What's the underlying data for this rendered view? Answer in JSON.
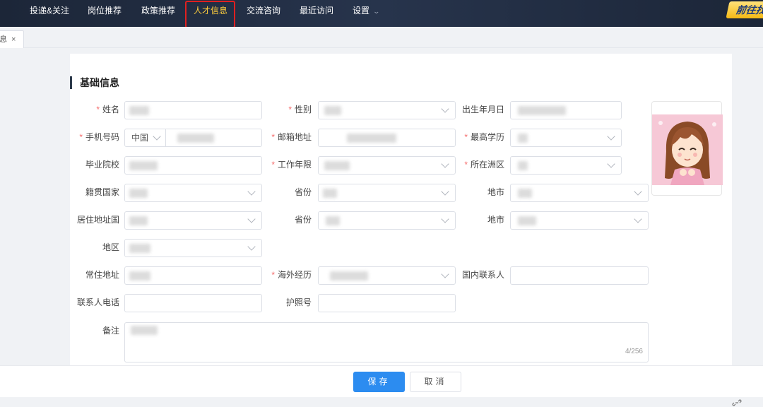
{
  "nav": {
    "items": [
      "投递&关注",
      "岗位推荐",
      "政策推荐",
      "人才信息",
      "交流咨询",
      "最近访问",
      "设置"
    ],
    "active_index": 3,
    "goto_label": "前往找"
  },
  "tab": {
    "label": "息",
    "close": "×"
  },
  "section": {
    "title": "基础信息"
  },
  "form": {
    "name": {
      "label": "姓名",
      "required": "*"
    },
    "gender": {
      "label": "性别",
      "required": "*"
    },
    "birth": {
      "label": "出生年月日"
    },
    "phone": {
      "label": "手机号码",
      "required": "*",
      "country": "中国"
    },
    "email": {
      "label": "邮箱地址",
      "required": "*"
    },
    "education": {
      "label": "最高学历",
      "required": "*"
    },
    "school": {
      "label": "毕业院校"
    },
    "work_years": {
      "label": "工作年限",
      "required": "*"
    },
    "continent": {
      "label": "所在洲区",
      "required": "*"
    },
    "native_country": {
      "label": "籍贯国家"
    },
    "native_province": {
      "label": "省份"
    },
    "native_city": {
      "label": "地市"
    },
    "residence_country": {
      "label": "居住地址国"
    },
    "residence_province": {
      "label": "省份"
    },
    "residence_city": {
      "label": "地市"
    },
    "district": {
      "label": "地区"
    },
    "permanent_address": {
      "label": "常住地址"
    },
    "overseas": {
      "label": "海外经历",
      "required": "*"
    },
    "domestic_contact": {
      "label": "国内联系人"
    },
    "contact_phone": {
      "label": "联系人电话"
    },
    "passport": {
      "label": "护照号"
    },
    "remark": {
      "label": "备注",
      "counter": "4/256"
    }
  },
  "footer": {
    "save": "保存",
    "cancel": "取消"
  },
  "colors": {
    "nav_bg": "#1f2a3d",
    "nav_active": "#ffce3d",
    "primary": "#2c8cf0",
    "required": "#f56c6c",
    "highlight": "#e02020"
  }
}
